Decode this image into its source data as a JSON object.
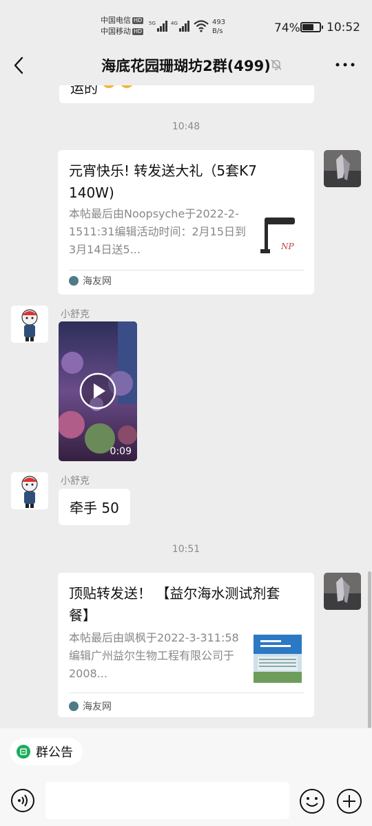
{
  "status_bar": {
    "carrier_1": "中国电信",
    "carrier_2": "中国移动",
    "hd_badge": "HD",
    "net_5g": "5G",
    "net_4g": "4G",
    "net_speed_value": "493",
    "net_speed_unit": "B/s",
    "battery_percent": "74%",
    "battery_level": 0.74,
    "time": "10:52"
  },
  "nav": {
    "title": "海底花园珊瑚坊2群(499)",
    "back_icon": "chevron-left-icon",
    "mute_icon": "bell-off-icon",
    "more_icon": "more-dots-icon"
  },
  "messages": {
    "partial_top_text": "运的",
    "time_1": "10:48",
    "card_1": {
      "title": "元宵快乐! 转发送大礼（5套K7 140W)",
      "desc": "本帖最后由Noopsyche于2022-2-1511:31编辑活动时间：2月15日到3月14日送5...",
      "source": "海友网",
      "thumb_text": "NP"
    },
    "sender_1": "小舒克",
    "video_duration": "0:09",
    "sender_2": "小舒克",
    "text_msg": "牵手 50",
    "time_2": "10:51",
    "card_2": {
      "title": "顶贴转发送！ 【益尔海水测试剂套餐】",
      "desc": "本帖最后由飒枫于2022-3-311:58编辑广州益尔生物工程有限公司于2008...",
      "source": "海友网"
    }
  },
  "bottom": {
    "notice_label": "群公告",
    "input_value": "",
    "voice_icon": "voice-icon",
    "emoji_icon": "emoji-icon",
    "plus_icon": "plus-icon"
  },
  "colors": {
    "background": "#ededed",
    "bubble": "#ffffff",
    "accent_green": "#1aad5b",
    "timestamp_gray": "#8a8a8a"
  }
}
